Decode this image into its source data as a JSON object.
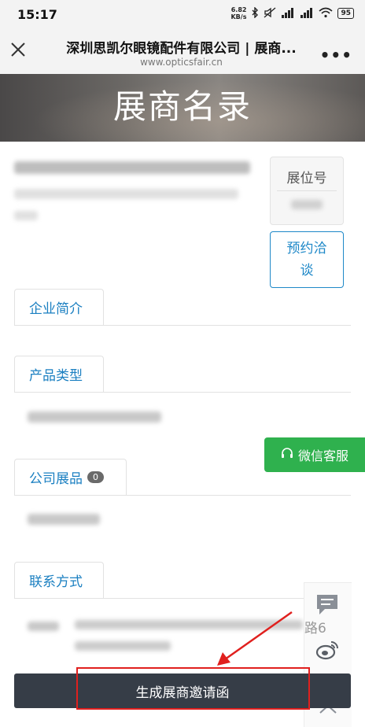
{
  "status_bar": {
    "time": "15:17",
    "net_speed_value": "6.82",
    "net_speed_unit": "KB/s",
    "battery": "95"
  },
  "browser": {
    "title": "深圳思凯尔眼镜配件有限公司 | 展商...",
    "url": "www.opticsfair.cn"
  },
  "banner": {
    "title": "展商名录"
  },
  "exhibitor": {
    "booth_label": "展位号",
    "appointment_button": "预约洽谈"
  },
  "tabs": [
    {
      "label": "企业简介"
    },
    {
      "label": "产品类型"
    },
    {
      "label": "公司展品",
      "badge": "0"
    },
    {
      "label": "联系方式"
    }
  ],
  "wechat_service": {
    "label": "微信客服"
  },
  "contact": {
    "address_tail": "路6"
  },
  "generate_button": {
    "label": "生成展商邀请函"
  },
  "colors": {
    "accent_blue": "#1a7fc1",
    "wechat_green": "#2fb14e",
    "generate_bar": "#363d47",
    "highlight_red": "#e0201e"
  }
}
